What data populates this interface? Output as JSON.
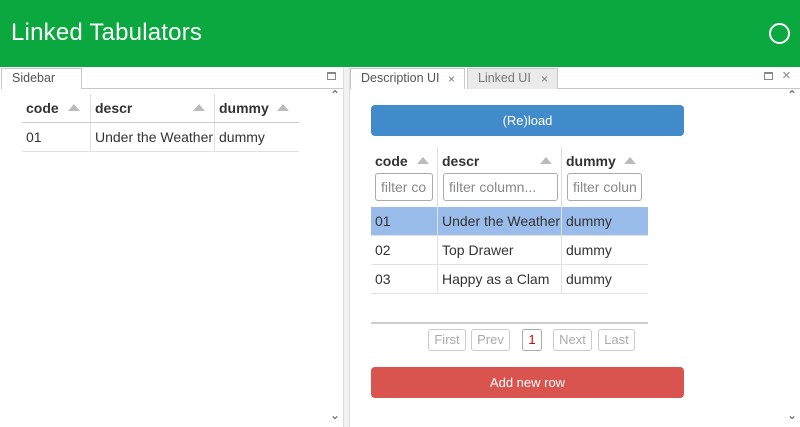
{
  "header": {
    "title": "Linked Tabulators"
  },
  "sidebar": {
    "tab_label": "Sidebar",
    "columns": [
      "code",
      "descr",
      "dummy"
    ],
    "rows": [
      {
        "code": "01",
        "descr": "Under the Weather",
        "dummy": "dummy"
      }
    ]
  },
  "main": {
    "tabs": [
      {
        "label": "Description UI",
        "close": "×"
      },
      {
        "label": "Linked UI",
        "close": "×"
      }
    ],
    "reload_label": "(Re)load",
    "columns": [
      "code",
      "descr",
      "dummy"
    ],
    "filters": [
      "filter co",
      "filter column...",
      "filter colun"
    ],
    "rows": [
      {
        "code": "01",
        "descr": "Under the Weather",
        "dummy": "dummy",
        "selected": true
      },
      {
        "code": "02",
        "descr": "Top Drawer",
        "dummy": "dummy",
        "selected": false
      },
      {
        "code": "03",
        "descr": "Happy as a Clam",
        "dummy": "dummy",
        "selected": false
      }
    ],
    "pager": {
      "first": "First",
      "prev": "Prev",
      "page": "1",
      "next": "Next",
      "last": "Last"
    },
    "add_row_label": "Add new row"
  },
  "window_controls": {
    "close": "×",
    "up": "⌃",
    "down": "⌄"
  },
  "colors": {
    "header": "#0aa83f",
    "reload": "#428bca",
    "add": "#d9534f",
    "selected_row": "#9abcea"
  }
}
